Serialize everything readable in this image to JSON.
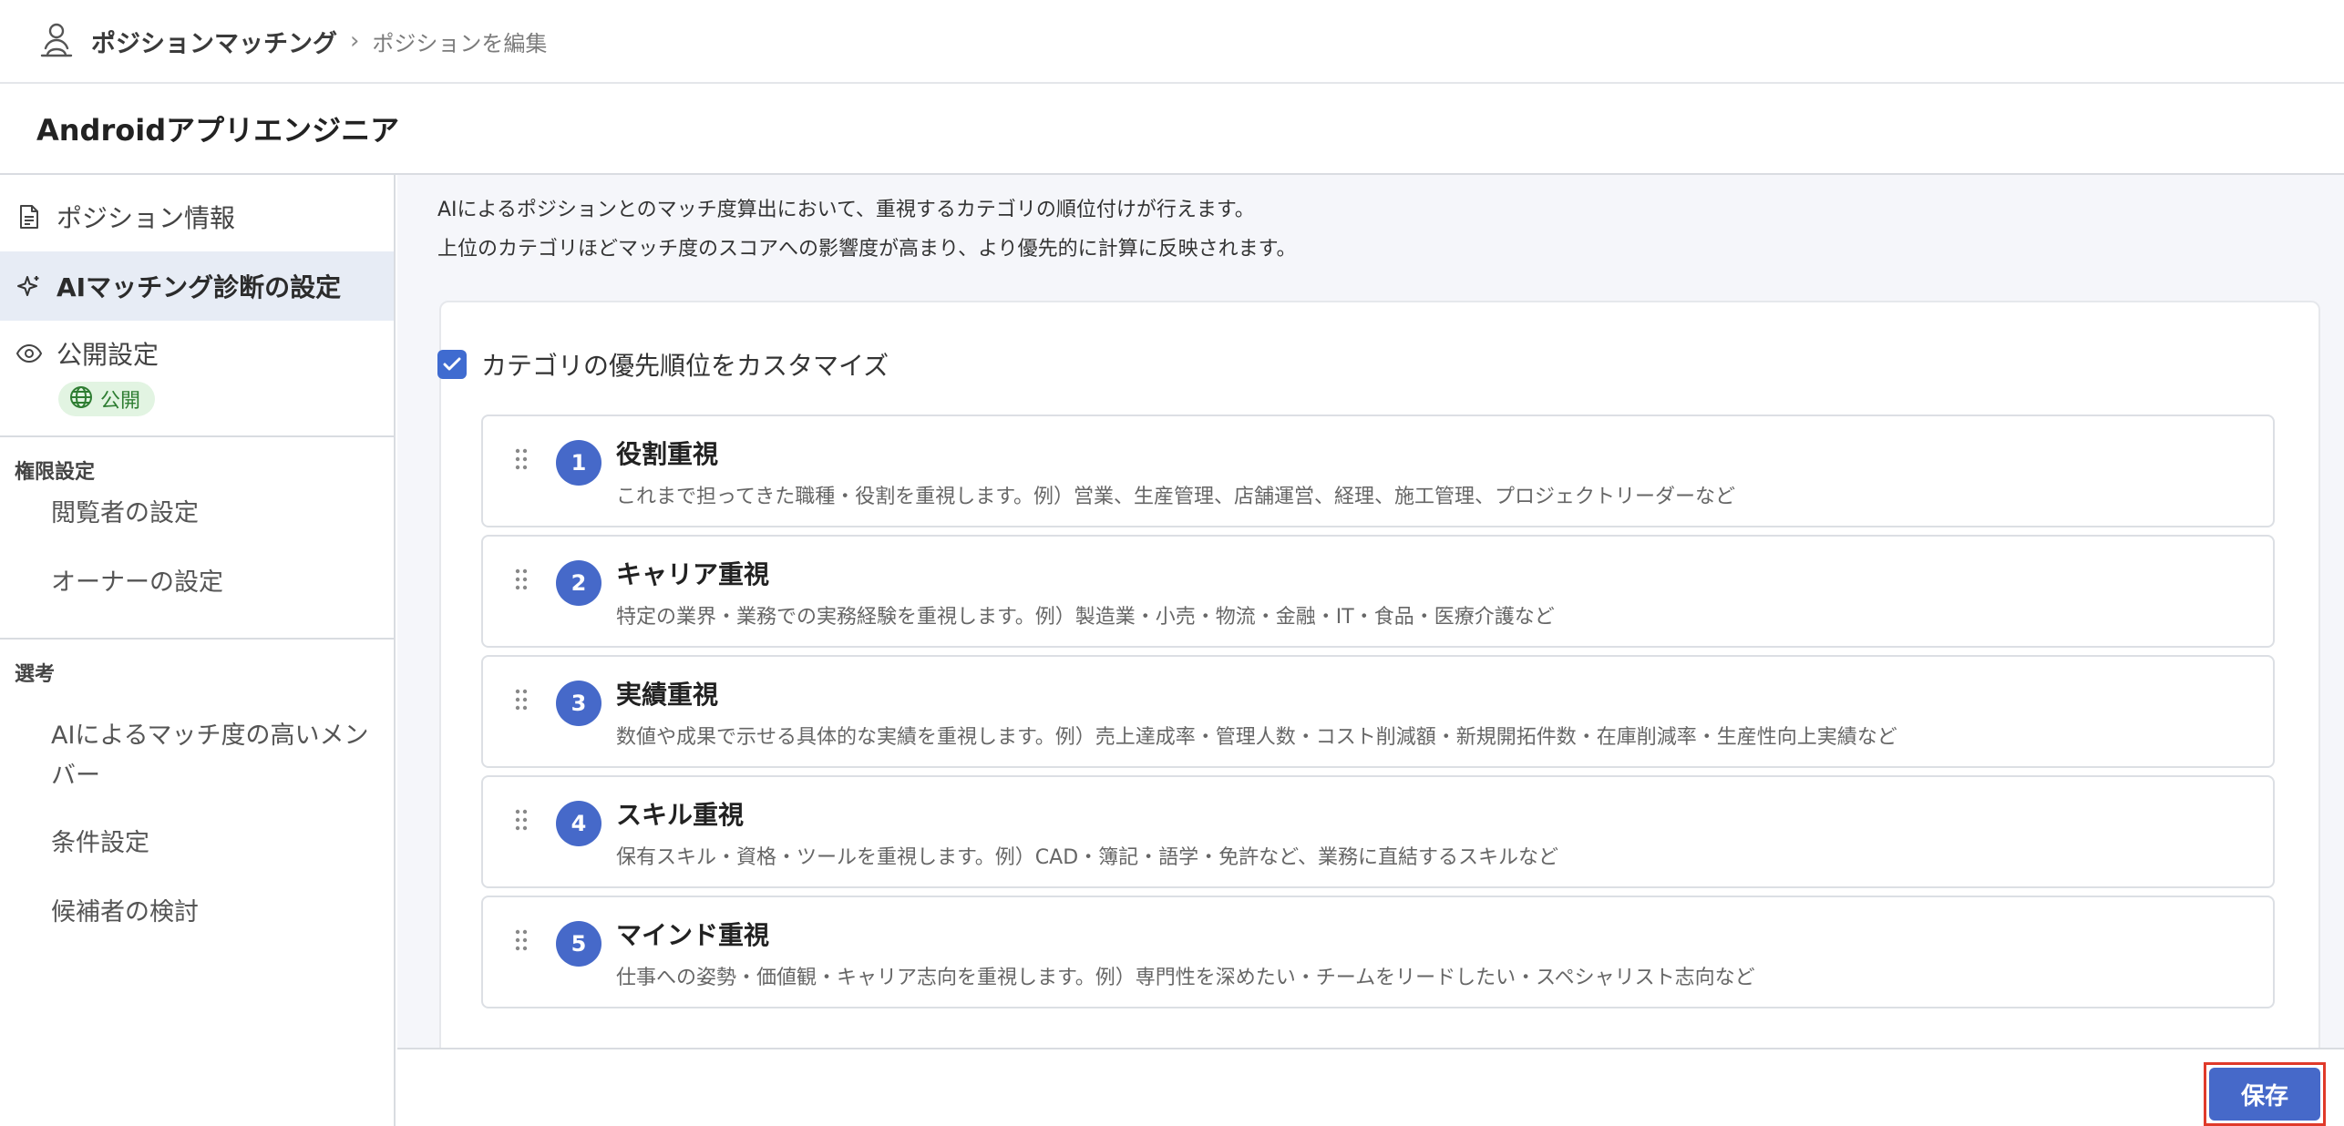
{
  "app": {
    "title": "ポジションマッチング",
    "breadcrumb_sep": "›",
    "breadcrumb_current": "ポジションを編集"
  },
  "page": {
    "title": "Androidアプリエンジニア"
  },
  "sidebar": {
    "items": [
      {
        "label": "ポジション情報",
        "icon": "document-icon"
      },
      {
        "label": "AIマッチング診断の設定",
        "icon": "sparkle-icon",
        "active": true
      },
      {
        "label": "公開設定",
        "icon": "eye-icon",
        "badge": "公開",
        "badge_icon": "globe-icon"
      }
    ],
    "sections": [
      {
        "heading": "権限設定",
        "items": [
          "閲覧者の設定",
          "オーナーの設定"
        ]
      },
      {
        "heading": "選考",
        "items": [
          "AIによるマッチ度の高いメンバー",
          "条件設定",
          "候補者の検討"
        ]
      }
    ]
  },
  "main": {
    "intro_line1": "AIによるポジションとのマッチ度算出において、重視するカテゴリの順位付けが行えます。",
    "intro_line2": "上位のカテゴリほどマッチ度のスコアへの影響度が高まり、より優先的に計算に反映されます。",
    "customize_label": "カテゴリの優先順位をカスタマイズ",
    "customize_checked": true,
    "categories": [
      {
        "rank": "1",
        "title": "役割重視",
        "desc": "これまで担ってきた職種・役割を重視します。例）営業、生産管理、店舗運営、経理、施工管理、プロジェクトリーダーなど"
      },
      {
        "rank": "2",
        "title": "キャリア重視",
        "desc": "特定の業界・業務での実務経験を重視します。例）製造業・小売・物流・金融・IT・食品・医療介護など"
      },
      {
        "rank": "3",
        "title": "実績重視",
        "desc": "数値や成果で示せる具体的な実績を重視します。例）売上達成率・管理人数・コスト削減額・新規開拓件数・在庫削減率・生産性向上実績など"
      },
      {
        "rank": "4",
        "title": "スキル重視",
        "desc": "保有スキル・資格・ツールを重視します。例）CAD・簿記・語学・免許など、業務に直結するスキルなど"
      },
      {
        "rank": "5",
        "title": "マインド重視",
        "desc": "仕事への姿勢・価値観・キャリア志向を重視します。例）専門性を深めたい・チームをリードしたい・スペシャリスト志向など"
      }
    ]
  },
  "footer": {
    "save_label": "保存"
  },
  "colors": {
    "accent": "#4669c9",
    "active_bg": "#e7ecf5",
    "badge_bg": "#e2f4e2",
    "badge_text": "#2e7d32",
    "highlight_border": "#e03a2a"
  }
}
